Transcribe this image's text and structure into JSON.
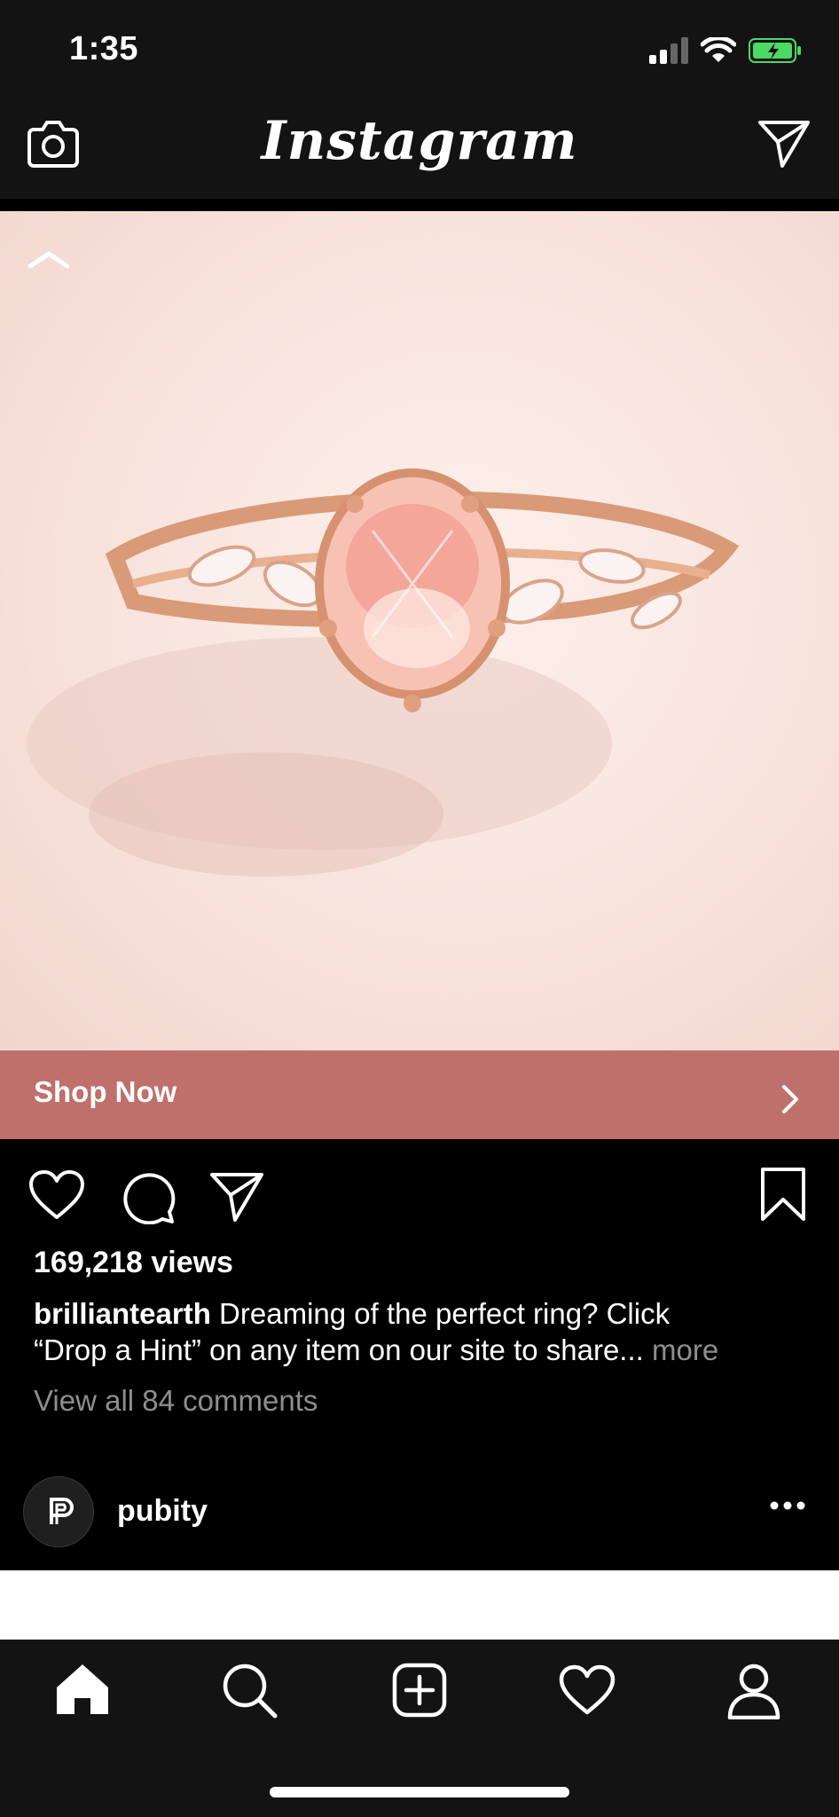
{
  "status_bar": {
    "time": "1:35",
    "icons": [
      "cellular-signal-icon",
      "wifi-icon",
      "battery-charging-icon"
    ]
  },
  "nav": {
    "title": "Instagram",
    "left_icon": "camera-icon",
    "right_icon": "direct-message-icon"
  },
  "post": {
    "media_description_icon": "ring-photo",
    "cta_label": "Shop Now",
    "views": "169,218 views",
    "username": "brilliantearth",
    "caption_line1": "Dreaming of the perfect ring? Click",
    "caption_line2": "“Drop a Hint” on any item on our site to share...",
    "more_label": "more",
    "comments_link": "View all 84 comments"
  },
  "next_post": {
    "username": "pubity",
    "avatar_icon": "pubity-logo-icon",
    "menu_icon": "more-options-icon"
  },
  "tab_bar": {
    "items": [
      "home-icon",
      "search-icon",
      "new-post-icon",
      "activity-heart-icon",
      "profile-icon"
    ]
  },
  "colors": {
    "cta_background": "#c0706a",
    "bar_background": "#131313"
  }
}
